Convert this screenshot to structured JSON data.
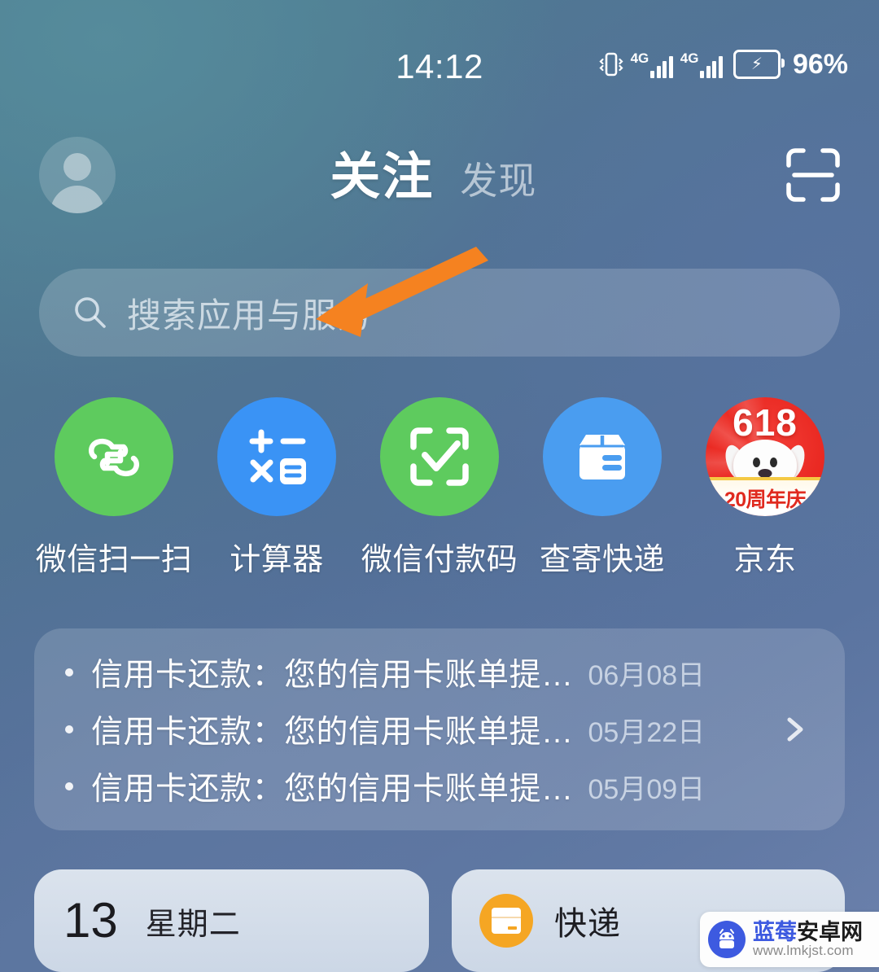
{
  "status_bar": {
    "time": "14:12",
    "battery_percent": "96%",
    "network_label_1": "4G",
    "network_label_2": "4G",
    "vibrate_icon": "vibrate-icon",
    "battery_icon": "battery-charging-icon"
  },
  "header": {
    "avatar_icon": "avatar-icon",
    "tab_active": "关注",
    "tab_inactive": "发现",
    "scan_icon": "scan-icon"
  },
  "search": {
    "placeholder": "搜索应用与服务",
    "icon": "search-icon"
  },
  "shortcuts": [
    {
      "label": "微信扫一扫",
      "icon": "wechat-scan-icon",
      "color": "#5ecb5e"
    },
    {
      "label": "计算器",
      "icon": "calculator-icon",
      "color": "#3a93f5"
    },
    {
      "label": "微信付款码",
      "icon": "wechat-payment-code-icon",
      "color": "#5ecb5e"
    },
    {
      "label": "查寄快递",
      "icon": "package-box-icon",
      "color": "#4a9df0"
    },
    {
      "label": "京东",
      "icon": "jd-618-icon",
      "color": "#e8261f",
      "badge_number": "618",
      "badge_text": "20周年庆"
    }
  ],
  "notification_card": {
    "rows": [
      {
        "text": "信用卡还款：您的信用卡账单提…",
        "date": "06月08日"
      },
      {
        "text": "信用卡还款：您的信用卡账单提…",
        "date": "05月22日"
      },
      {
        "text": "信用卡还款：您的信用卡账单提…",
        "date": "05月09日"
      }
    ],
    "chevron_icon": "chevron-right-icon"
  },
  "widgets": {
    "calendar": {
      "day": "13",
      "weekday": "星期二"
    },
    "express": {
      "label": "快递",
      "icon": "express-box-icon",
      "color": "#f5a623"
    }
  },
  "annotation": {
    "arrow_icon": "arrow-pointer-icon",
    "color": "#f58220"
  },
  "watermark": {
    "name_part1": "蓝莓",
    "name_part2": "安卓网",
    "url": "www.lmkjst.com",
    "logo_icon": "android-robot-icon"
  }
}
